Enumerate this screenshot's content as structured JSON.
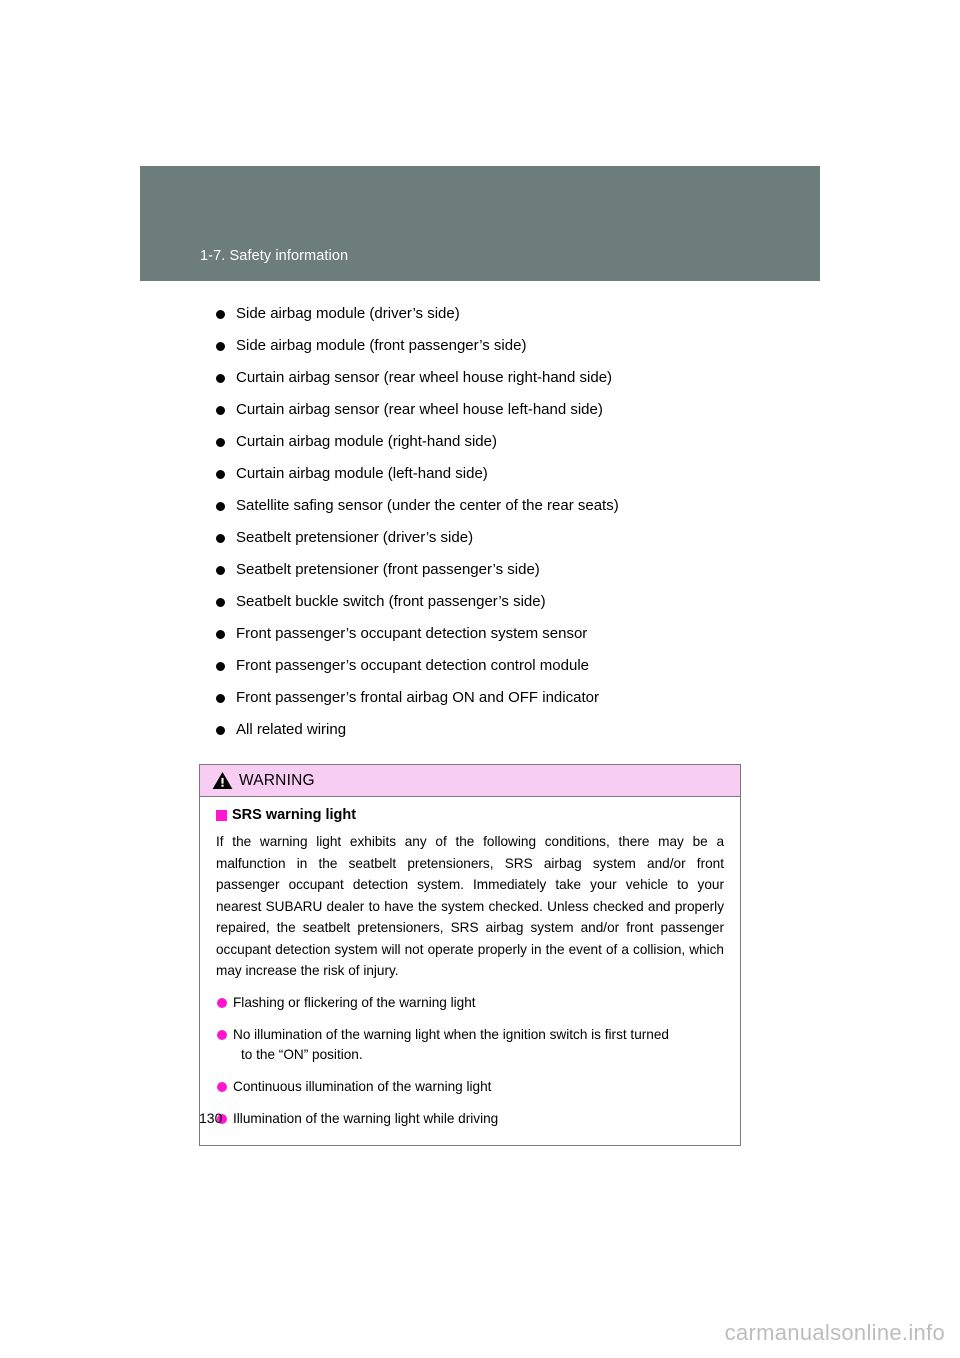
{
  "page": {
    "number": "130",
    "watermark": "carmanualsonline.info",
    "header_band_color": "#6d7d7c"
  },
  "chapter": {
    "title": "1-7. Safety information"
  },
  "components": {
    "items": [
      {
        "label": "Side airbag module (driver’s side)"
      },
      {
        "label": "Side airbag module (front passenger’s side)"
      },
      {
        "label": "Curtain airbag sensor (rear wheel house right-hand side)"
      },
      {
        "label": "Curtain airbag sensor (rear wheel house left-hand side)"
      },
      {
        "label": "Curtain airbag module (right-hand side)"
      },
      {
        "label": "Curtain airbag module (left-hand side)"
      },
      {
        "label": "Satellite safing sensor (under the center of the rear seats)"
      },
      {
        "label": "Seatbelt pretensioner (driver’s side)"
      },
      {
        "label": "Seatbelt pretensioner (front passenger’s side)"
      },
      {
        "label": "Seatbelt buckle switch (front passenger’s side)"
      },
      {
        "label": "Front passenger’s occupant detection system sensor"
      },
      {
        "label": "Front passenger’s occupant detection control module"
      },
      {
        "label": "Front passenger’s frontal airbag ON and OFF indicator"
      },
      {
        "label": "All related wiring"
      }
    ]
  },
  "warning": {
    "header_label": "WARNING",
    "header_bg": "#f7cdf4",
    "accent_color": "#ff16d1",
    "subheading": "SRS warning light",
    "paragraph": "If the warning light exhibits any of the following conditions, there may be a malfunction in the seatbelt pretensioners, SRS airbag system and/or front passenger occupant detection system. Immediately take your vehicle to your nearest SUBARU dealer to have the system checked. Unless checked and properly repaired, the seatbelt pretensioners, SRS airbag system and/or front passenger occupant detection system will not operate properly in the event of a collision, which may increase the risk of injury.",
    "conditions": [
      {
        "line1": "Flashing or flickering of the warning light",
        "line2": ""
      },
      {
        "line1": "No illumination of the warning light when the ignition switch is first turned",
        "line2": "to the “ON” position."
      },
      {
        "line1": "Continuous illumination of the warning light",
        "line2": ""
      },
      {
        "line1": "Illumination of the warning light while driving",
        "line2": ""
      }
    ]
  }
}
